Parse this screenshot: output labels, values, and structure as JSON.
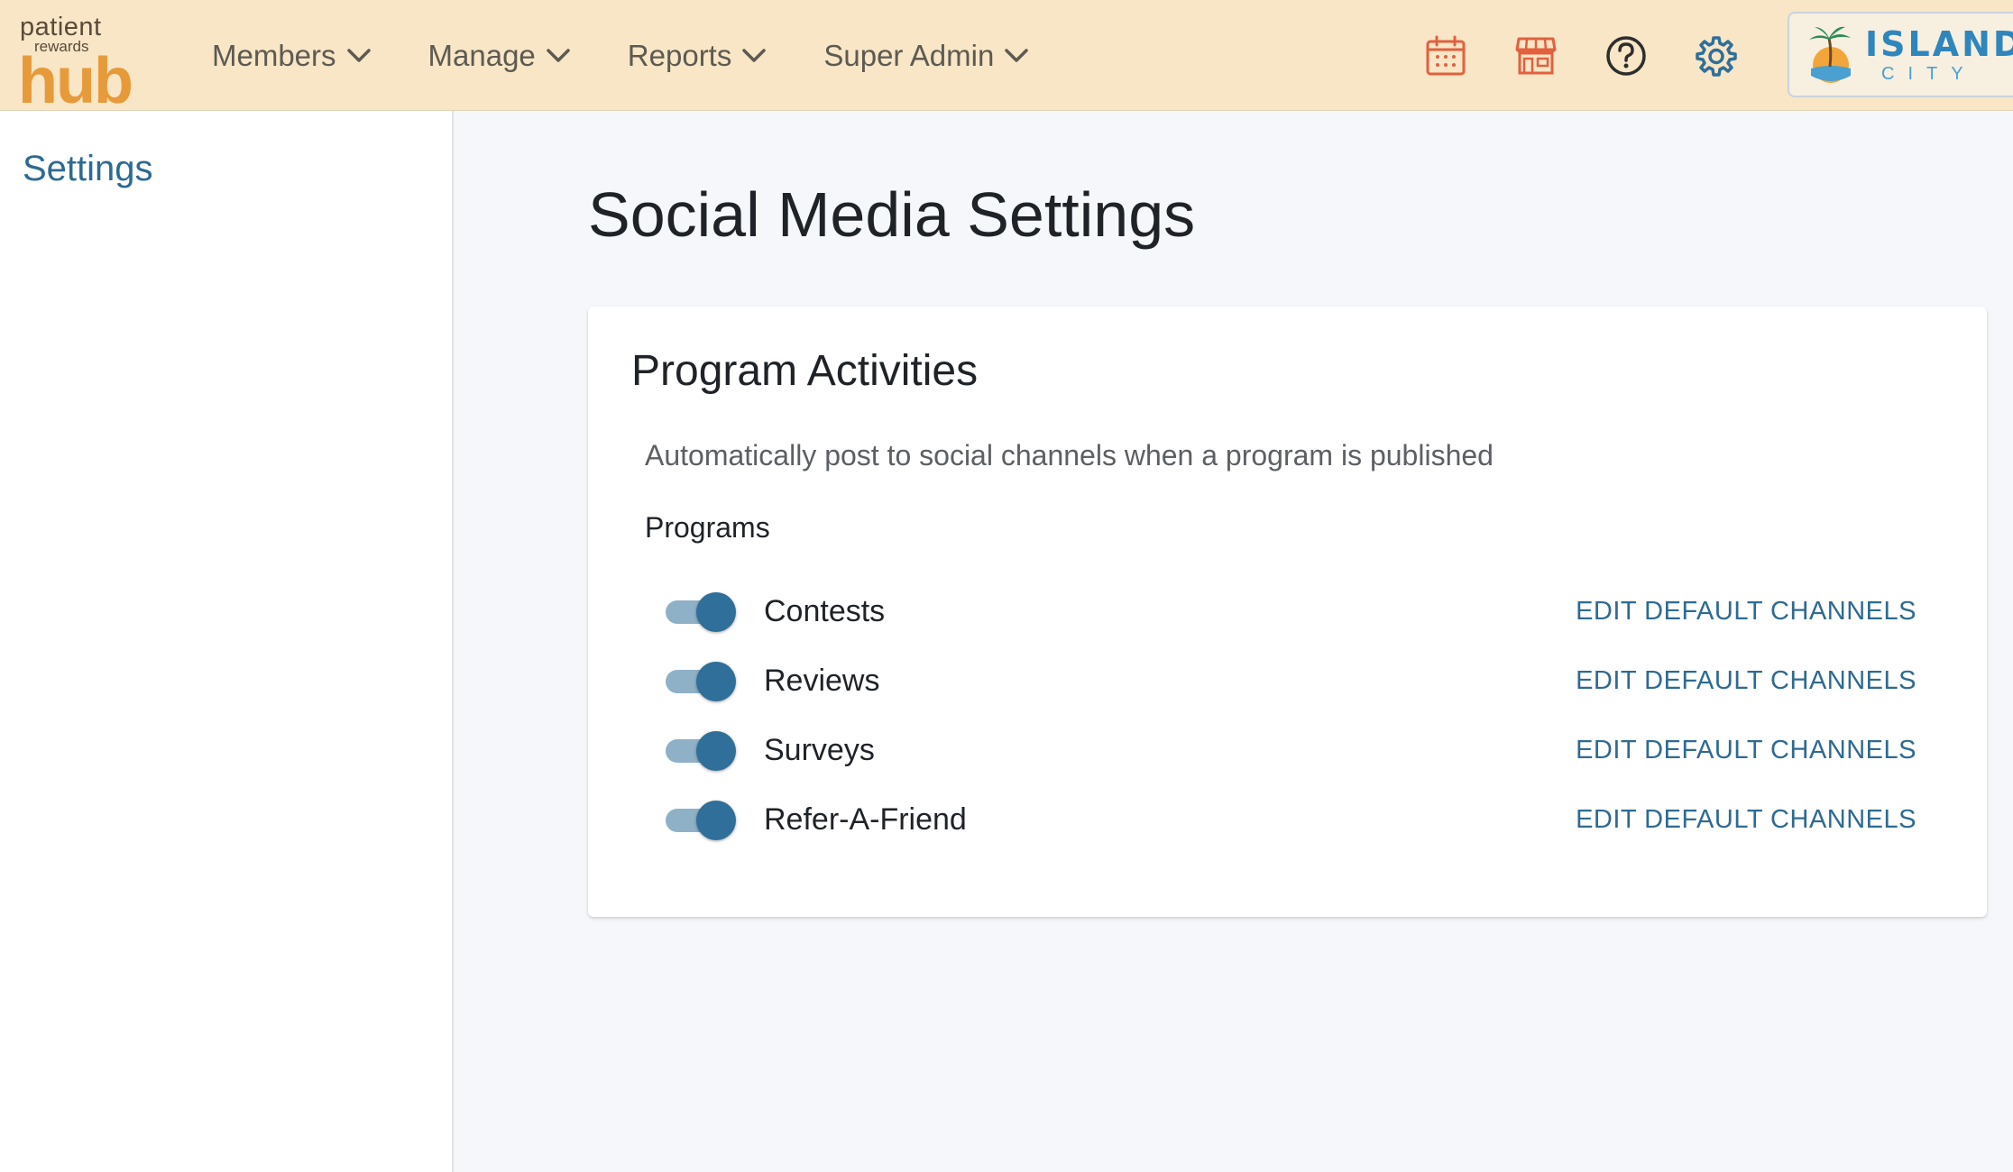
{
  "brand": {
    "line1": "patient",
    "line2": "rewards",
    "line3": "hub"
  },
  "nav": {
    "items": [
      {
        "label": "Members"
      },
      {
        "label": "Manage"
      },
      {
        "label": "Reports"
      },
      {
        "label": "Super Admin"
      }
    ]
  },
  "header_icons": [
    {
      "icon": "calendar-icon",
      "color": "#e2603f"
    },
    {
      "icon": "storefront-icon",
      "color": "#e2603f"
    },
    {
      "icon": "help-circle-icon",
      "color": "#2d2d2d"
    },
    {
      "icon": "gear-icon",
      "color": "#2f6f99"
    }
  ],
  "org": {
    "name": "ISLAND",
    "subtitle": "CITY"
  },
  "sidebar": {
    "items": [
      {
        "label": "Settings"
      }
    ]
  },
  "page": {
    "title": "Social Media Settings"
  },
  "card": {
    "title": "Program Activities",
    "description": "Automatically post to social channels when a program is published",
    "section_label": "Programs",
    "programs": [
      {
        "label": "Contests",
        "enabled": true,
        "action": "EDIT DEFAULT CHANNELS"
      },
      {
        "label": "Reviews",
        "enabled": true,
        "action": "EDIT DEFAULT CHANNELS"
      },
      {
        "label": "Surveys",
        "enabled": true,
        "action": "EDIT DEFAULT CHANNELS"
      },
      {
        "label": "Refer-A-Friend",
        "enabled": true,
        "action": "EDIT DEFAULT CHANNELS"
      }
    ]
  },
  "colors": {
    "header_bg": "#f8e6c6",
    "accent": "#2e6a92",
    "toggle_on": "#2f6f99",
    "brand_orange": "#e79a3a"
  }
}
